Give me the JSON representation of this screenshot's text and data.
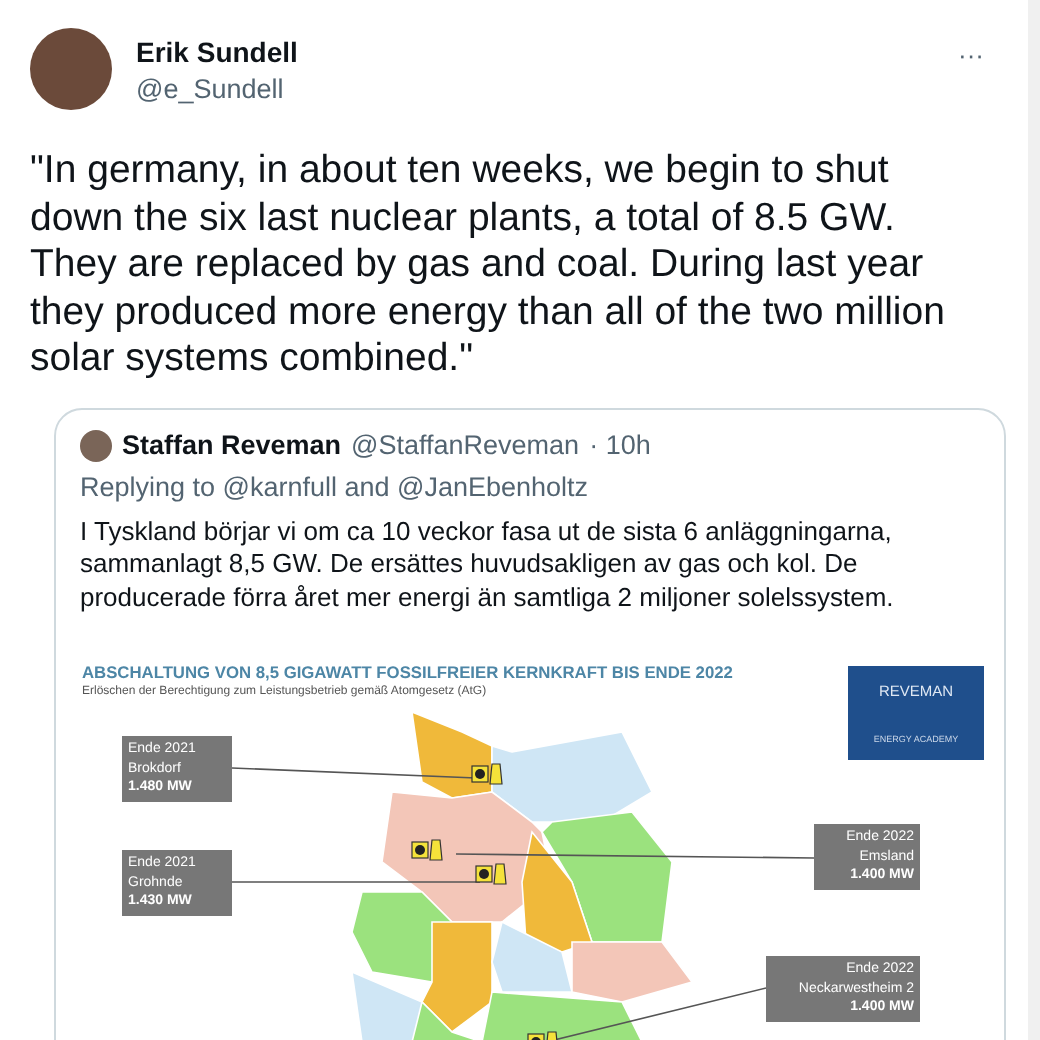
{
  "author": {
    "name": "Erik Sundell",
    "handle": "@e_Sundell"
  },
  "more": "···",
  "text": "\"In germany, in about ten weeks, we begin to shut down the six last nuclear plants, a total of 8.5 GW. They are replaced by gas and coal. During last year they produced more energy than all of the two million solar systems combined.\"",
  "quoted": {
    "name": "Staffan Reveman",
    "handle": "@StaffanReveman",
    "time": "· 10h",
    "replying_to": "Replying to @karnfull and @JanEbenholtz",
    "text": "I Tyskland börjar vi om ca 10 veckor fasa ut de sista 6 anläggningarna, sammanlagt 8,5 GW. De ersättes huvudsakligen av gas och kol. De producerade förra året mer energi än samtliga 2 miljoner solelssystem.",
    "infographic": {
      "title": "ABSCHALTUNG VON 8,5 GIGAWATT FOSSILFREIER KERNKRAFT BIS ENDE 2022",
      "subtitle": "Erlöschen der Berechtigung zum Leistungsbetrieb gemäß Atomgesetz (AtG)",
      "logo": {
        "name": "REVEMAN",
        "tagline": "ENERGY ACADEMY"
      },
      "plants": [
        {
          "date": "Ende 2021",
          "plant": "Brokdorf",
          "capacity": "1.480 MW"
        },
        {
          "date": "Ende 2021",
          "plant": "Grohnde",
          "capacity": "1.430 MW"
        },
        {
          "date": "Ende 2022",
          "plant": "Emsland",
          "capacity": "1.400 MW"
        },
        {
          "date": "Ende 2022",
          "plant": "Neckarwestheim 2",
          "capacity": "1.400 MW"
        }
      ]
    }
  }
}
